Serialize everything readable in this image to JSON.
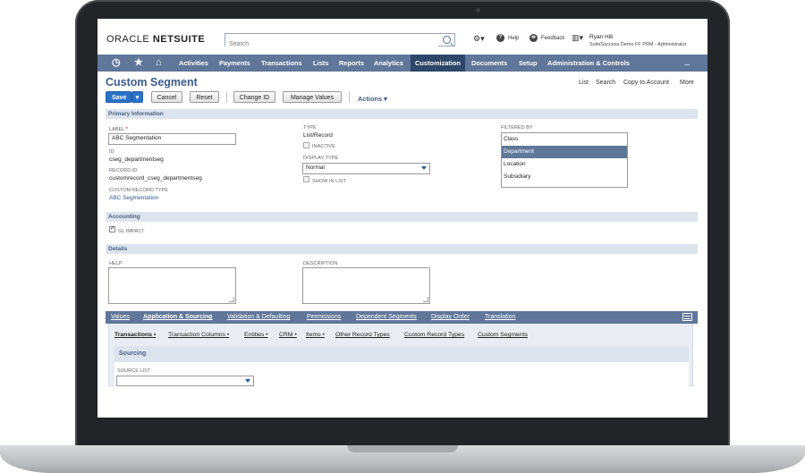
{
  "header": {
    "logo_oracle": "ORACLE",
    "logo_netsuite": "NETSUITE",
    "search_placeholder": "Search",
    "help_label": "Help",
    "feedback_label": "Feedback",
    "user_name": "Ryan Hill",
    "user_role": "SuiteSuccess Demo FF PRM - Administrator"
  },
  "nav": {
    "items": [
      "Activities",
      "Payments",
      "Transactions",
      "Lists",
      "Reports",
      "Analytics",
      "Customization",
      "Documents",
      "Setup",
      "Administration & Controls"
    ],
    "more": "...",
    "active": "Customization"
  },
  "page": {
    "title": "Custom Segment",
    "top_links": [
      "List",
      "Search",
      "Copy to Account",
      "More"
    ]
  },
  "toolbar": {
    "save": "Save",
    "cancel": "Cancel",
    "reset": "Reset",
    "change_id": "Change ID",
    "manage_values": "Manage Values",
    "actions": "Actions ▾"
  },
  "primary": {
    "section": "Primary Information",
    "label_label": "LABEL",
    "label_required": "*",
    "label_value": "ABC Segmentation",
    "id_label": "ID",
    "id_value": "cseg_departmentseg",
    "record_id_label": "RECORD ID",
    "record_id_value": "customrecord_cseg_departmentseg",
    "custom_record_type_label": "CUSTOM RECORD TYPE",
    "custom_record_type_value": "ABC Segmentation",
    "type_label": "TYPE",
    "type_value": "List/Record",
    "inactive_label": "INACTIVE",
    "display_type_label": "DISPLAY TYPE",
    "display_type_value": "Normal",
    "show_in_list_label": "SHOW IN LIST",
    "filtered_by_label": "FILTERED BY",
    "filtered_by_options": [
      "Class",
      "Department",
      "Location",
      "Subsidiary"
    ],
    "filtered_by_selected": "Department"
  },
  "accounting": {
    "section": "Accounting",
    "gl_impact_label": "GL IMPACT",
    "gl_impact_checked": true
  },
  "details": {
    "section": "Details",
    "help_label": "HELP",
    "description_label": "DESCRIPTION"
  },
  "subtabs": {
    "items": [
      "Values",
      "Application & Sourcing",
      "Validation & Defaulting",
      "Permissions",
      "Dependent Segments",
      "Display Order",
      "Translation"
    ],
    "active": "Application & Sourcing"
  },
  "subsubtabs": {
    "items": [
      "Transactions •",
      "Transaction Columns •",
      "Entities •",
      "CRM •",
      "Items •",
      "Other Record Types",
      "Custom Record Types",
      "Custom Segments"
    ],
    "active": "Transactions •"
  },
  "sourcing": {
    "section": "Sourcing",
    "source_list_label": "SOURCE LIST",
    "source_list_value": ""
  },
  "colors": {
    "nav_bg": "#607799",
    "nav_active": "#2e4768",
    "title_blue": "#3b5a8c",
    "primary_button": "#2a72c8",
    "section_bg": "#dde4ee"
  }
}
